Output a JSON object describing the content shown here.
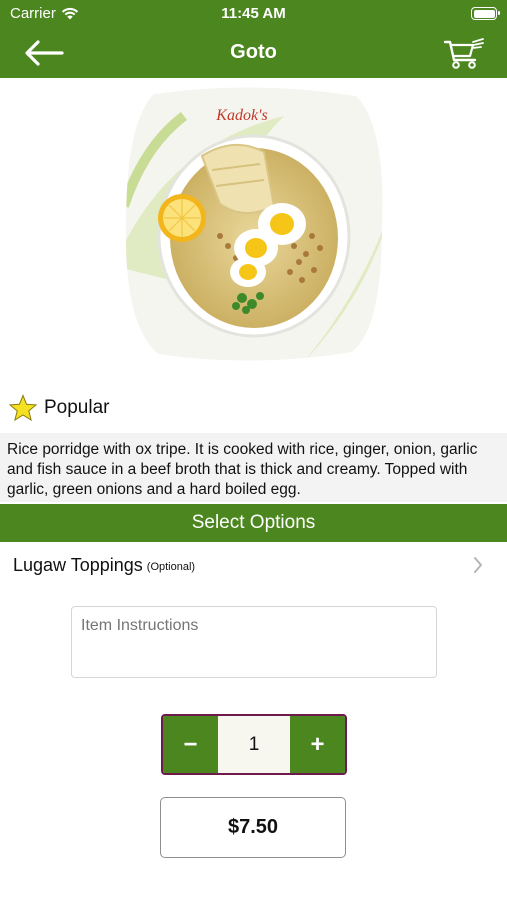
{
  "status_bar": {
    "carrier": "Carrier",
    "time": "11:45 AM"
  },
  "nav": {
    "title": "Goto",
    "back_icon": "arrow-left-icon",
    "cart_icon": "cart-icon"
  },
  "image": {
    "brand_text": "Kadok's"
  },
  "badge": {
    "icon": "star-icon",
    "label": "Popular",
    "star_color": "#f5e021"
  },
  "description": "Rice porridge with ox tripe. It is cooked with rice, ginger, onion, garlic and fish sauce in a beef broth that is thick and creamy. Topped with garlic, green onions and a hard boiled egg.",
  "options": {
    "header": "Select Options",
    "groups": [
      {
        "name": "Lugaw Toppings",
        "tag": "(Optional)"
      }
    ]
  },
  "instructions": {
    "placeholder": "Item Instructions"
  },
  "quantity": {
    "decrement_label": "−",
    "value": "1",
    "increment_label": "+"
  },
  "price": "$7.50",
  "colors": {
    "brand_green": "#4b861f",
    "stepper_border": "#6e1a4d"
  }
}
